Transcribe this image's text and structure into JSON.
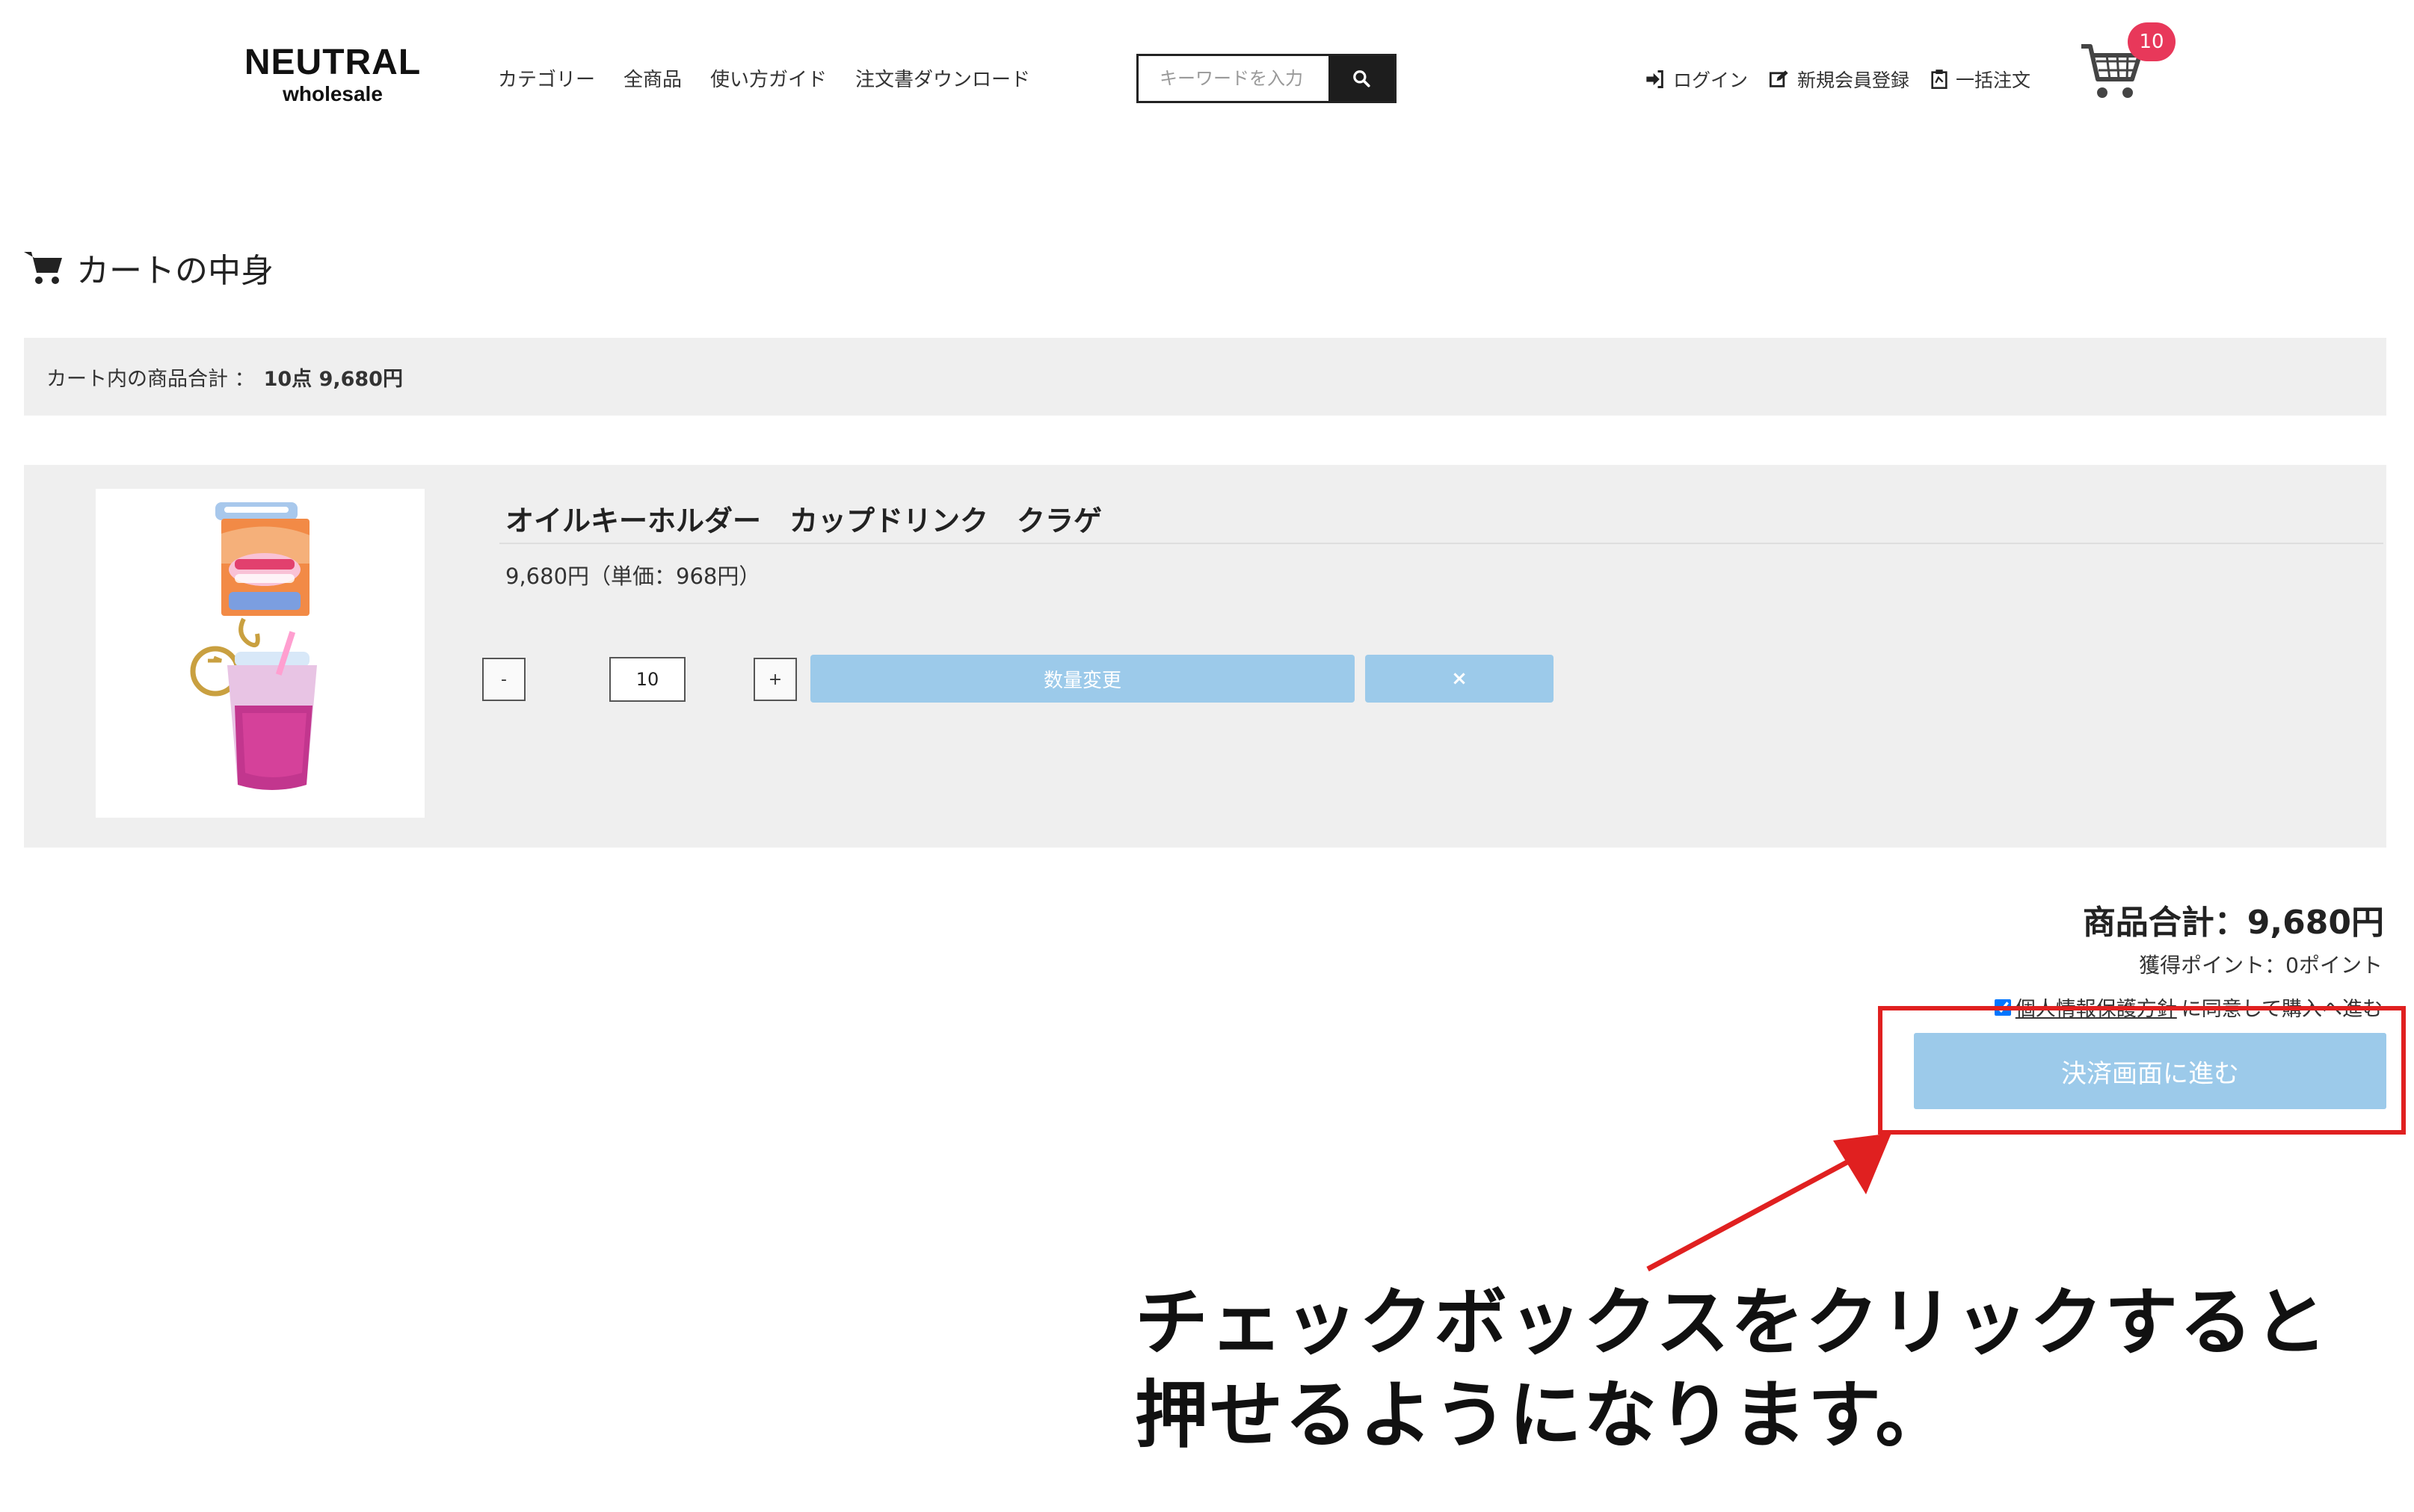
{
  "header": {
    "logo_line1": "NEUTRAL",
    "logo_line2": "wholesale",
    "nav": [
      "カテゴリー",
      "全商品",
      "使い方ガイド",
      "注文書ダウンロード"
    ],
    "search_placeholder": "キーワードを入力",
    "login": "ログイン",
    "register": "新規会員登録",
    "bulk_order": "一括注文",
    "cart_count": "10"
  },
  "page": {
    "title": "カートの中身"
  },
  "summary": {
    "label": "カート内の商品合計 ：",
    "value": "10点  9,680円"
  },
  "item": {
    "name": "オイルキーホルダー　カップドリンク　クラゲ",
    "price": "9,680円（単価：968円）",
    "minus": "-",
    "quantity": "10",
    "plus": "+",
    "update_label": "数量変更",
    "remove_label": "×"
  },
  "totals": {
    "total": "商品合計：9,680円",
    "points": "獲得ポイント：0ポイント",
    "privacy_link": "個人情報保護方針",
    "agree_text": "に同意して購入へ進む",
    "checkout": "決済画面に進む"
  },
  "annotation": {
    "line1": "チェックボックスをクリックすると",
    "line2": "押せるようになります。"
  },
  "colors": {
    "accent_blue": "#9ccaea",
    "badge_red": "#e8385a",
    "highlight_red": "#e02020",
    "panel_gray": "#efefef"
  },
  "icons": [
    "cart-icon",
    "search-icon",
    "login-icon",
    "edit-icon",
    "clipboard-icon",
    "shopping-cart-icon",
    "arrow-icon"
  ]
}
